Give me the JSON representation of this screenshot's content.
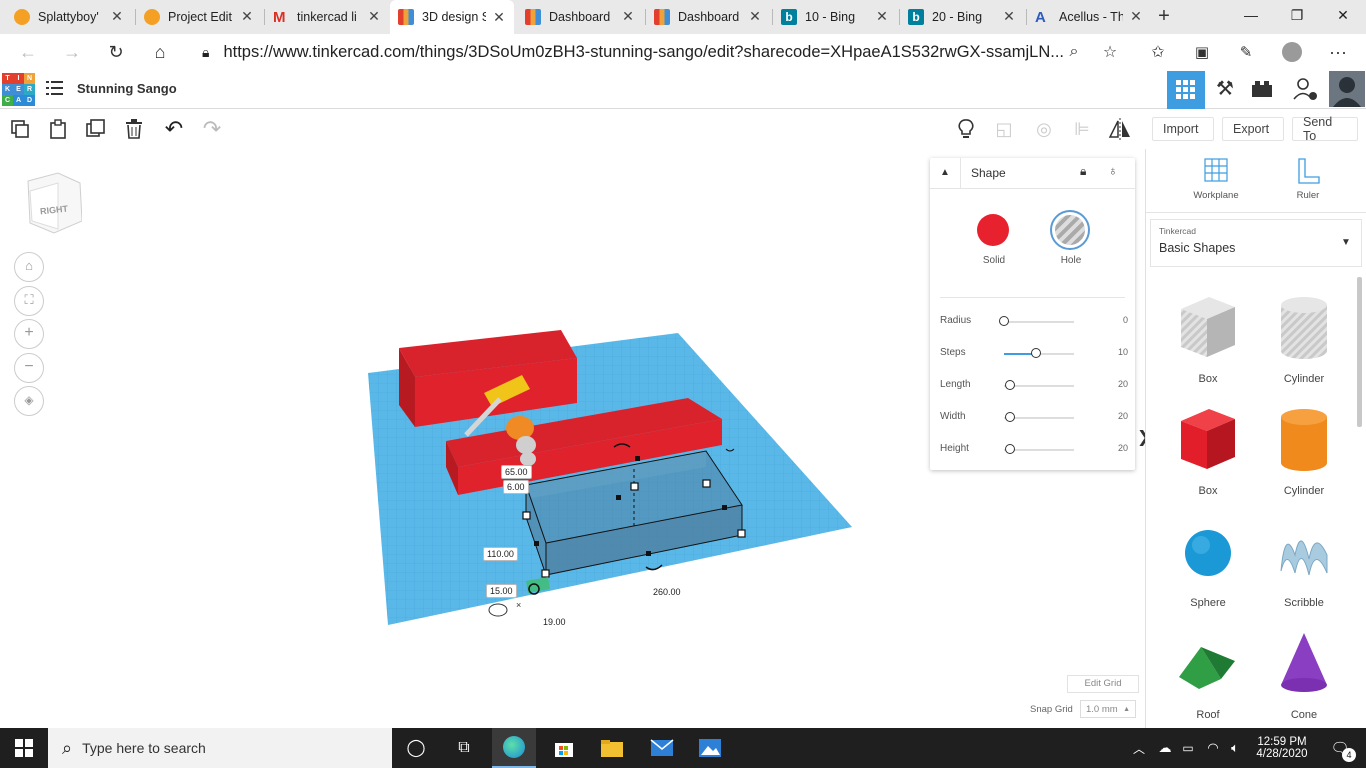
{
  "browser": {
    "tabs": [
      {
        "title": "Splattyboy'",
        "icon": "pumpkin-icon",
        "active": false
      },
      {
        "title": "Project Edit",
        "icon": "pumpkin-icon",
        "active": false
      },
      {
        "title": "tinkercad li",
        "icon": "gmail-icon",
        "active": false
      },
      {
        "title": "3D design S",
        "icon": "tinkercad-icon",
        "active": true
      },
      {
        "title": "Dashboard",
        "icon": "tinkercad-icon",
        "active": false
      },
      {
        "title": "Dashboard",
        "icon": "tinkercad-icon",
        "active": false
      },
      {
        "title": "10 - Bing",
        "icon": "bing-icon",
        "active": false
      },
      {
        "title": "20 - Bing",
        "icon": "bing-icon",
        "active": false
      },
      {
        "title": "Acellus - Th",
        "icon": "acellus-icon",
        "active": false
      }
    ],
    "new_tab": "+",
    "url": "https://www.tinkercad.com/things/3DSoUm0zBH3-stunning-sango/edit?sharecode=XHpaeA1S532rwGX-ssamjLN...",
    "menu": "···"
  },
  "app": {
    "logo_letters": [
      "T",
      "I",
      "N",
      "K",
      "E",
      "R",
      "C",
      "A",
      "D"
    ],
    "logo_colors": [
      "#e2402c",
      "#e2402c",
      "#f0a23a",
      "#3f8fd6",
      "#3f8fd6",
      "#2ba9c7",
      "#3fae49",
      "#2c8ad6",
      "#2c8ad6"
    ],
    "project_title": "Stunning Sango",
    "toolbar": {
      "import": "Import",
      "export": "Export",
      "send_to": "Send To"
    }
  },
  "viewcube": {
    "face": "RIGHT"
  },
  "inspector": {
    "title": "Shape",
    "solid_label": "Solid",
    "hole_label": "Hole",
    "solid_color": "#e8212f",
    "params": [
      {
        "label": "Radius",
        "value": "0",
        "fraction": 0.0
      },
      {
        "label": "Steps",
        "value": "10",
        "fraction": 0.45
      },
      {
        "label": "Length",
        "value": "20",
        "fraction": 0.08
      },
      {
        "label": "Width",
        "value": "20",
        "fraction": 0.08
      },
      {
        "label": "Height",
        "value": "20",
        "fraction": 0.08
      }
    ]
  },
  "dimensions": {
    "d1": "65.00",
    "d2": "6.00",
    "d3": "110.00",
    "d4": "15.00",
    "d5": "19.00",
    "d6": "260.00"
  },
  "grid": {
    "edit_grid": "Edit Grid",
    "snap_label": "Snap Grid",
    "snap_value": "1.0 mm",
    "workplane_color": "#5ab8e8"
  },
  "right_panel": {
    "workplane": "Workplane",
    "ruler": "Ruler",
    "library_small": "Tinkercad",
    "library_name": "Basic Shapes",
    "shapes": [
      {
        "name": "Box",
        "kind": "box-hole"
      },
      {
        "name": "Cylinder",
        "kind": "cylinder-hole"
      },
      {
        "name": "Box",
        "kind": "box-red"
      },
      {
        "name": "Cylinder",
        "kind": "cylinder-orange"
      },
      {
        "name": "Sphere",
        "kind": "sphere-blue"
      },
      {
        "name": "Scribble",
        "kind": "scribble"
      },
      {
        "name": "Roof",
        "kind": "roof-green"
      },
      {
        "name": "Cone",
        "kind": "cone-purple"
      }
    ]
  },
  "taskbar": {
    "search_placeholder": "Type here to search",
    "time": "12:59 PM",
    "date": "4/28/2020",
    "notifications": "4"
  }
}
